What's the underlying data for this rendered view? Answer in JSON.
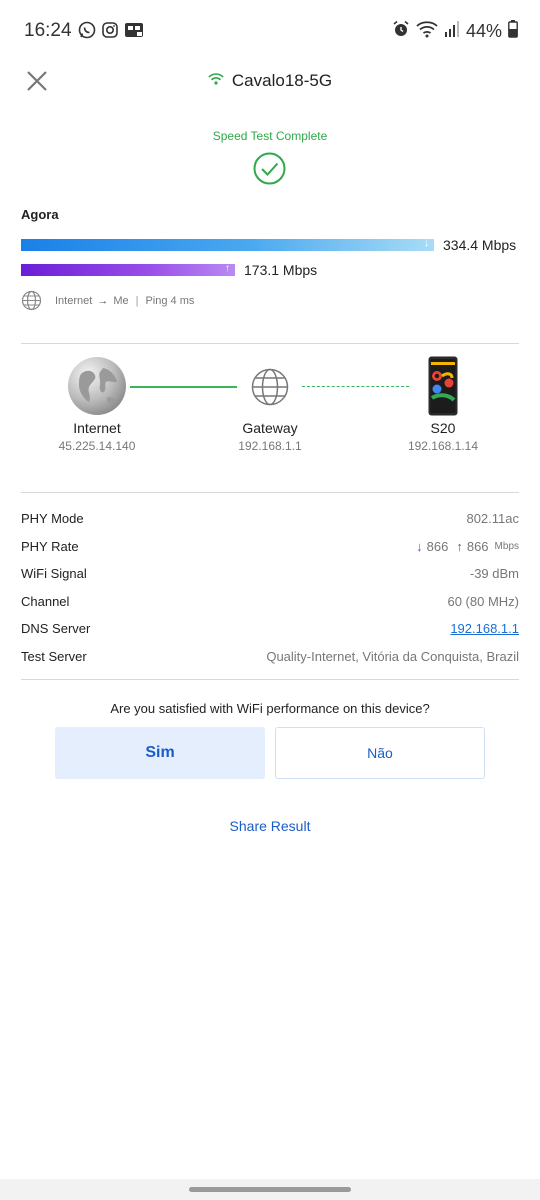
{
  "status_bar": {
    "time": "16:24",
    "left_icons": [
      "whatsapp-icon",
      "instagram-icon",
      "tv-icon"
    ],
    "right_icons": [
      "alarm-icon",
      "wifi-icon",
      "signal-icon",
      "battery-icon"
    ],
    "battery": "44%"
  },
  "header": {
    "close_icon": "close-icon",
    "wifi_icon": "wifi-icon",
    "network_name": "Cavalo18-5G"
  },
  "result": {
    "status": "Speed Test Complete",
    "time_label": "Agora",
    "download": "334.4 Mbps",
    "download_fraction": 0.83,
    "upload": "173.1 Mbps",
    "upload_fraction": 0.43,
    "route_from": "Internet",
    "route_to": "Me",
    "ping": "Ping 4 ms"
  },
  "diagram": {
    "internet": {
      "name": "Internet",
      "ip": "45.225.14.140"
    },
    "gateway": {
      "name": "Gateway",
      "ip": "192.168.1.1"
    },
    "device": {
      "name": "S20",
      "ip": "192.168.1.14"
    }
  },
  "details": [
    {
      "label": "PHY Mode",
      "value": "802.11ac"
    },
    {
      "label": "PHY Rate",
      "down": "866",
      "up": "866",
      "unit": "Mbps"
    },
    {
      "label": "WiFi Signal",
      "value": "-39 dBm"
    },
    {
      "label": "Channel",
      "value": "60 (80 MHz)"
    },
    {
      "label": "DNS Server",
      "value": "192.168.1.1"
    },
    {
      "label": "Test Server",
      "value": "Quality-Internet, Vitória da Conquista, Brazil"
    }
  ],
  "feedback": {
    "question": "Are you satisfied with WiFi performance on this device?",
    "yes": "Sim",
    "no": "Não"
  },
  "share": "Share Result",
  "colors": {
    "accent": "#1a5cc8",
    "success": "#2ea84a",
    "download_bar": "#1a80e8",
    "upload_bar": "#6a1ed6"
  }
}
